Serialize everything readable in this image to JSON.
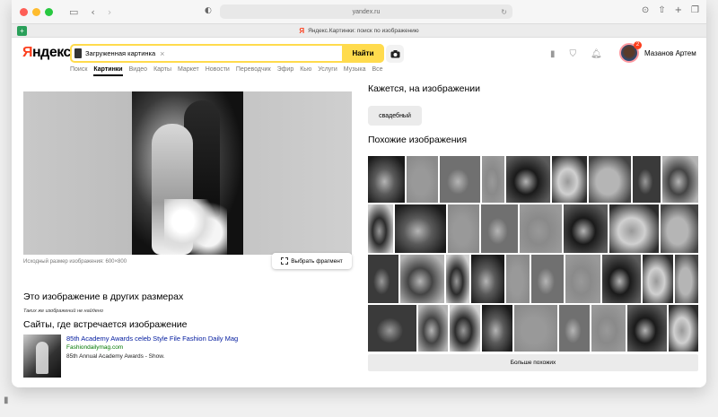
{
  "browser": {
    "url": "yandex.ru",
    "tab_title": "Яндекс.Картинки: поиск по изображению",
    "tab_icon": "Я"
  },
  "header": {
    "logo_ya": "Я",
    "logo_rest": "ндекс",
    "search_chip": "Загруженная картинка",
    "search_button": "Найти",
    "notification_count": "2",
    "username": "Мазанов Артем"
  },
  "nav": {
    "items": [
      "Поиск",
      "Картинки",
      "Видео",
      "Карты",
      "Маркет",
      "Новости",
      "Переводчик",
      "Эфир",
      "Кью",
      "Услуги",
      "Музыка",
      "Все"
    ],
    "active_index": 1
  },
  "left": {
    "original_size": "Исходный размер изображения: 600×800",
    "fragment_button": "Выбрать фрагмент",
    "other_sizes_title": "Это изображение в других размерах",
    "other_sizes_empty": "Таких же изображений не найдено",
    "sites_title": "Сайты, где встречается изображение",
    "site": {
      "title": "85th Academy Awards celeb Style File Fashion Daily Mag",
      "domain": "Fashiondailymag.com",
      "description": "85th Annual Academy Awards - Show."
    }
  },
  "right": {
    "seems_title": "Кажется, на изображении",
    "seems_tag": "свадебный",
    "similar_title": "Похожие изображения",
    "more_button": "Больше похожих"
  }
}
